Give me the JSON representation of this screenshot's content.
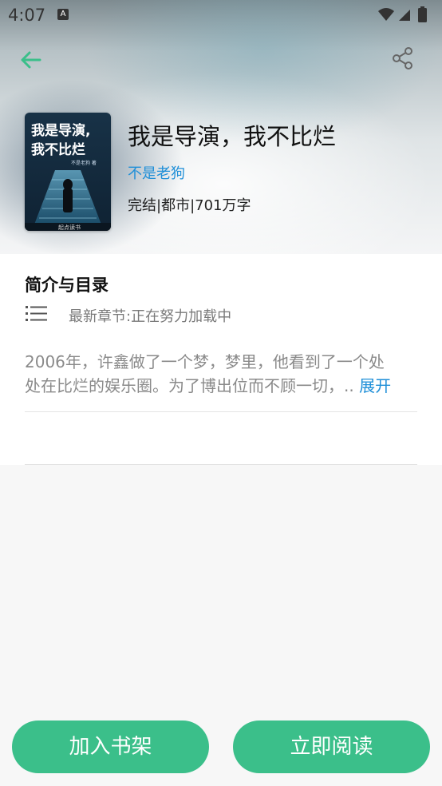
{
  "status_bar": {
    "time": "4:07",
    "notification_letter": "A"
  },
  "nav": {
    "back_icon": "arrow-left-icon",
    "share_icon": "share-icon",
    "accent": "#3bbf8a"
  },
  "book": {
    "title": "我是导演，我不比烂",
    "author": "不是老狗",
    "meta": "完结|都市|701万字",
    "cover": {
      "line1": "我是导演,",
      "line2": "我不比烂",
      "small_author": "不是老狗 著",
      "publisher": "起点读书"
    }
  },
  "intro_section": {
    "title": "简介与目录",
    "latest_chapter": "最新章节:正在努力加载中",
    "summary_line1": "2006年，许鑫做了一个梦，梦里，他看到了一个处",
    "summary_line2": "处在比烂的娱乐圈。为了博出位而不顾一切，..",
    "expand_label": "展开",
    "link_color": "#1f8fd8"
  },
  "actions": {
    "add_shelf_label": "加入书架",
    "read_now_label": "立即阅读"
  }
}
